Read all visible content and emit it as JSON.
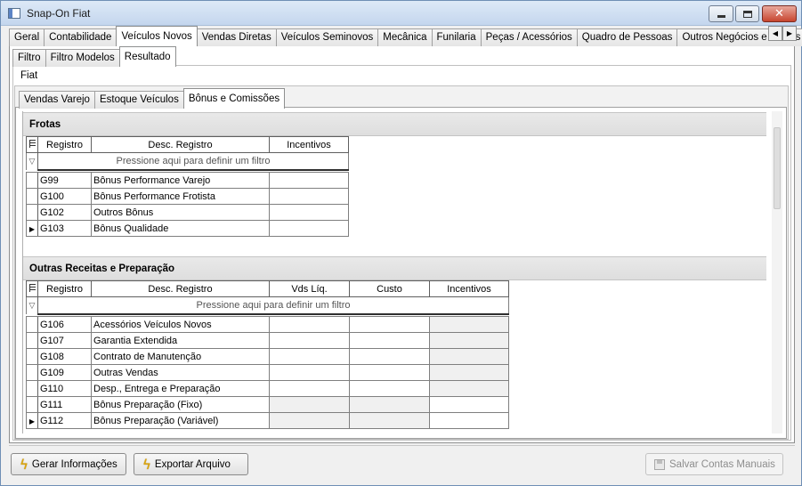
{
  "window": {
    "title": "Snap-On Fiat"
  },
  "tabs_main": [
    {
      "label": "Geral",
      "active": false
    },
    {
      "label": "Contabilidade",
      "active": false
    },
    {
      "label": "Veículos Novos",
      "active": true
    },
    {
      "label": "Vendas Diretas",
      "active": false
    },
    {
      "label": "Veículos Seminovos",
      "active": false
    },
    {
      "label": "Mecânica",
      "active": false
    },
    {
      "label": "Funilaria",
      "active": false
    },
    {
      "label": "Peças / Acessórios",
      "active": false
    },
    {
      "label": "Quadro de Pessoas",
      "active": false
    },
    {
      "label": "Outros Negócios e Outras Mar",
      "active": false
    }
  ],
  "tabs_sub": [
    {
      "label": "Filtro",
      "active": false
    },
    {
      "label": "Filtro Modelos",
      "active": false
    },
    {
      "label": "Resultado",
      "active": true
    }
  ],
  "group_label": "Fiat",
  "tabs_result": [
    {
      "label": "Vendas Varejo",
      "active": false
    },
    {
      "label": "Estoque Veículos",
      "active": false
    },
    {
      "label": "Bônus e Comissões",
      "active": true
    }
  ],
  "frotas": {
    "title": "Frotas",
    "filter_hint": "Pressione aqui para definir um filtro",
    "columns": [
      "Registro",
      "Desc. Registro",
      "Incentivos"
    ],
    "rows": [
      {
        "registro": "G99",
        "desc": "Bônus Performance Varejo",
        "incentivos": "",
        "current": false
      },
      {
        "registro": "G100",
        "desc": "Bônus Performance Frotista",
        "incentivos": "",
        "current": false
      },
      {
        "registro": "G102",
        "desc": "Outros Bônus",
        "incentivos": "",
        "current": false
      },
      {
        "registro": "G103",
        "desc": "Bônus Qualidade",
        "incentivos": "",
        "current": true
      }
    ]
  },
  "outras": {
    "title": "Outras Receitas e Preparação",
    "filter_hint": "Pressione aqui para definir um filtro",
    "columns": [
      "Registro",
      "Desc. Registro",
      "Vds Líq.",
      "Custo",
      "Incentivos"
    ],
    "rows": [
      {
        "registro": "G106",
        "desc": "Acessórios Veículos Novos",
        "current": false,
        "gray": [
          false,
          false,
          true
        ]
      },
      {
        "registro": "G107",
        "desc": "Garantia Extendida",
        "current": false,
        "gray": [
          false,
          false,
          true
        ]
      },
      {
        "registro": "G108",
        "desc": "Contrato de Manutenção",
        "current": false,
        "gray": [
          false,
          false,
          true
        ]
      },
      {
        "registro": "G109",
        "desc": "Outras Vendas",
        "current": false,
        "gray": [
          false,
          false,
          true
        ]
      },
      {
        "registro": "G110",
        "desc": "Desp., Entrega e Preparação",
        "current": false,
        "gray": [
          false,
          false,
          true
        ]
      },
      {
        "registro": "G111",
        "desc": "Bônus Preparação (Fixo)",
        "current": false,
        "gray": [
          true,
          true,
          false
        ]
      },
      {
        "registro": "G112",
        "desc": "Bônus Preparação (Variável)",
        "current": true,
        "gray": [
          true,
          true,
          false
        ]
      }
    ]
  },
  "buttons": {
    "gerar": "Gerar Informações",
    "exportar": "Exportar Arquivo",
    "salvar": "Salvar Contas Manuais"
  }
}
